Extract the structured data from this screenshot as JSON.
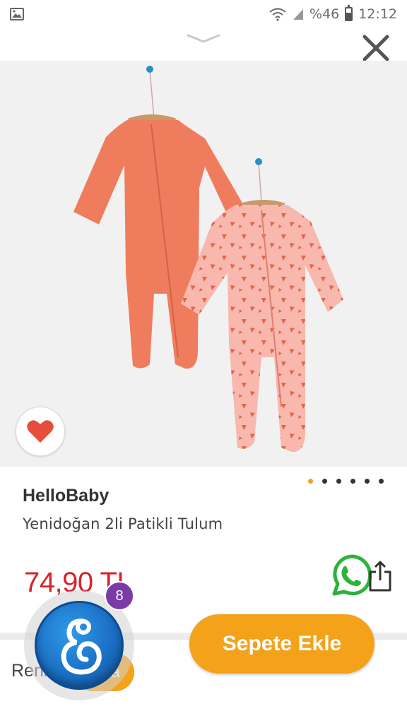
{
  "status_bar": {
    "battery_percent": "%46",
    "time": "12:12",
    "icons": [
      "image-notification-icon",
      "wifi-icon",
      "signal-icon",
      "battery-icon"
    ]
  },
  "sheet": {
    "handle_icon": "chevron-down-icon",
    "close_icon": "close-icon"
  },
  "product": {
    "brand": "HelloBaby",
    "name": "Yenidoğan 2li Patikli Tulum",
    "price": "74,90 TL",
    "favorite_icon": "heart-icon",
    "favorite_color": "#e74c3c",
    "image_count": 6,
    "active_image": 1
  },
  "actions": {
    "whatsapp_icon": "whatsapp-icon",
    "share_icon": "share-icon",
    "add_to_cart_label": "Sepete Ekle"
  },
  "options": {
    "color_label": "Renk",
    "color_value": "ra"
  },
  "chat": {
    "badge_count": "8",
    "icon": "chat-assistant-icon"
  },
  "colors": {
    "accent": "#f3a21a",
    "price": "#d8232a",
    "badge": "#7a3aa8",
    "chat_blue": "#1b6fc4"
  }
}
